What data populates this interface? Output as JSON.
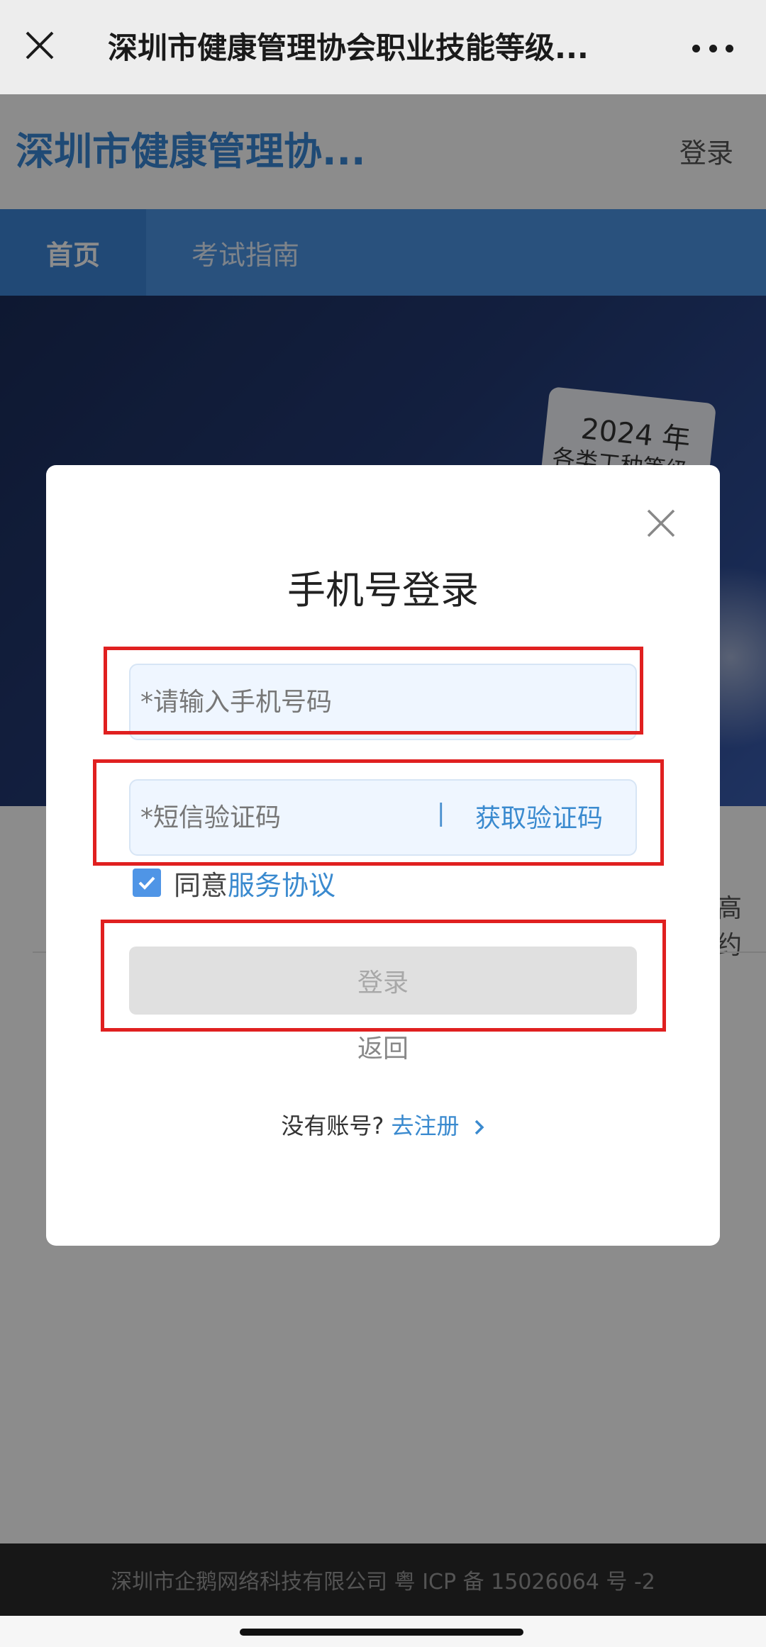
{
  "wechat_bar": {
    "title": "深圳市健康管理协会职业技能等级...",
    "close_icon": "close-icon",
    "more_icon": "more-icon"
  },
  "header": {
    "site_title": "深圳市健康管理协...",
    "login_label": "登录"
  },
  "nav": {
    "items": [
      {
        "label": "首页",
        "active": true
      },
      {
        "label": "考试指南",
        "active": false
      }
    ]
  },
  "banner": {
    "card_line1": "2024 年",
    "card_line2": "各类工种等级"
  },
  "page": {
    "side_fragment": "高约"
  },
  "modal": {
    "title": "手机号登录",
    "phone_placeholder": "*请输入手机号码",
    "code_placeholder": "*短信验证码",
    "code_separator": "|",
    "get_code_label": "获取验证码",
    "agree_prefix": "同意",
    "agree_link": "服务协议",
    "agree_checked": true,
    "login_button": "登录",
    "back_label": "返回",
    "no_account_label": "没有账号?",
    "register_link": "去注册"
  },
  "footer": {
    "text": "深圳市企鹅网络科技有限公司 粤 ICP 备 15026064 号 -2"
  },
  "colors": {
    "accent": "#3a8acf",
    "nav_bg": "#4c94e4",
    "annotation": "#e02020",
    "checkbox": "#4f95e6"
  }
}
